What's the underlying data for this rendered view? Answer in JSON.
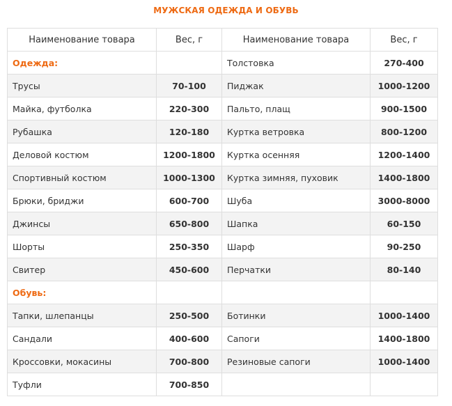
{
  "title": "МУЖСКАЯ ОДЕЖДА И ОБУВЬ",
  "accent_color": "#ee6a13",
  "headers": [
    "Наименование товара",
    "Вес, г",
    "Наименование товара",
    "Вес, г"
  ],
  "rows": [
    {
      "left_name": "Одежда:",
      "left_weight": "",
      "right_name": "Толстовка",
      "right_weight": "270-400",
      "left_section": true
    },
    {
      "left_name": "Трусы",
      "left_weight": "70-100",
      "right_name": "Пиджак",
      "right_weight": "1000-1200"
    },
    {
      "left_name": "Майка, футболка",
      "left_weight": "220-300",
      "right_name": "Пальто, плащ",
      "right_weight": "900-1500"
    },
    {
      "left_name": "Рубашка",
      "left_weight": "120-180",
      "right_name": "Куртка ветровка",
      "right_weight": "800-1200"
    },
    {
      "left_name": "Деловой костюм",
      "left_weight": "1200-1800",
      "right_name": "Куртка осенняя",
      "right_weight": "1200-1400"
    },
    {
      "left_name": "Спортивный костюм",
      "left_weight": "1000-1300",
      "right_name": "Куртка зимняя, пуховик",
      "right_weight": "1400-1800"
    },
    {
      "left_name": "Брюки, бриджи",
      "left_weight": "600-700",
      "right_name": "Шуба",
      "right_weight": "3000-8000"
    },
    {
      "left_name": "Джинсы",
      "left_weight": "650-800",
      "right_name": "Шапка",
      "right_weight": "60-150"
    },
    {
      "left_name": "Шорты",
      "left_weight": "250-350",
      "right_name": "Шарф",
      "right_weight": "90-250"
    },
    {
      "left_name": "Свитер",
      "left_weight": "450-600",
      "right_name": "Перчатки",
      "right_weight": "80-140"
    },
    {
      "left_name": "Обувь:",
      "left_weight": "",
      "right_name": "",
      "right_weight": "",
      "left_section": true
    },
    {
      "left_name": "Тапки, шлепанцы",
      "left_weight": "250-500",
      "right_name": "Ботинки",
      "right_weight": "1000-1400"
    },
    {
      "left_name": "Сандали",
      "left_weight": "400-600",
      "right_name": "Сапоги",
      "right_weight": "1400-1800"
    },
    {
      "left_name": "Кроссовки, мокасины",
      "left_weight": "700-800",
      "right_name": "Резиновые сапоги",
      "right_weight": "1000-1400"
    },
    {
      "left_name": "Туфли",
      "left_weight": "700-850",
      "right_name": "",
      "right_weight": ""
    }
  ]
}
